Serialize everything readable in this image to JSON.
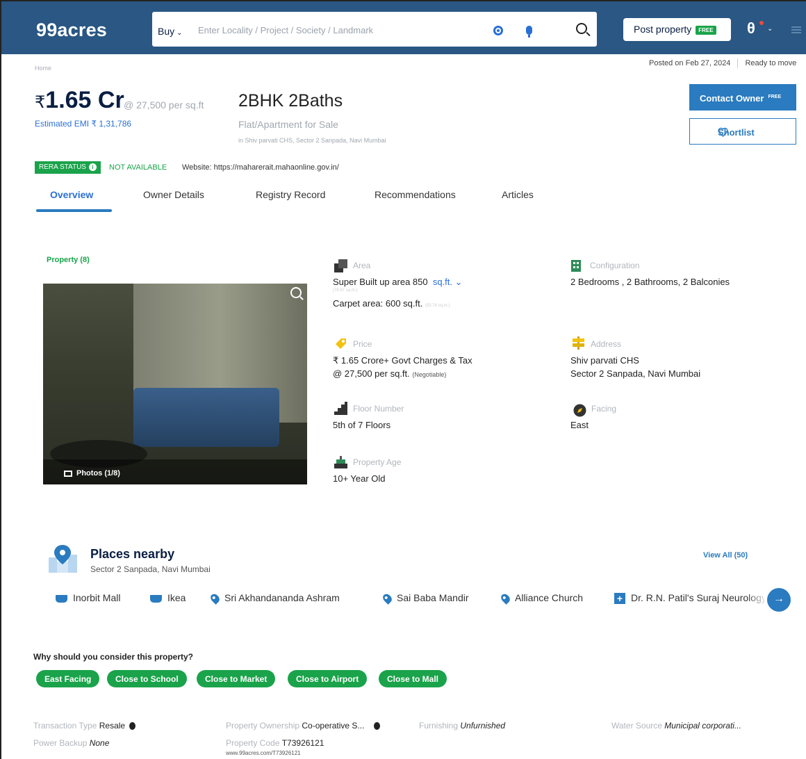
{
  "header": {
    "logo": "99acres",
    "search_mode": "Buy",
    "search_placeholder": "Enter Locality / Project / Society / Landmark",
    "post_property_label": "Post property",
    "post_property_badge": "FREE"
  },
  "breadcrumb": "Home",
  "posted": {
    "date": "Posted on Feb 27, 2024",
    "status": "Ready to move"
  },
  "listing": {
    "price": "1.65 Cr",
    "currency": "₹",
    "per_sqft": "@ 27,500 per sq.ft",
    "emi": "Estimated EMI ₹ 1,31,786",
    "title": "2BHK 2Baths",
    "subtitle": "Flat/Apartment for Sale",
    "address_line": "in Shiv parvati CHS, Sector 2 Sanpada, Navi Mumbai"
  },
  "actions": {
    "contact_owner": "Contact Owner",
    "contact_badge": "FREE",
    "shortlist": "Shortlist"
  },
  "rera": {
    "badge": "RERA STATUS",
    "status": "NOT AVAILABLE",
    "website": "Website: https://maharerait.mahaonline.gov.in/"
  },
  "tabs": [
    "Overview",
    "Owner Details",
    "Registry Record",
    "Recommendations",
    "Articles"
  ],
  "property_label": "Property (8)",
  "photos_label": "Photos (1/8)",
  "details": {
    "area": {
      "label": "Area",
      "value": "Super Built up area 850",
      "unit": "sq.ft.",
      "sub": "(78.97 sq.m.)",
      "carpet": "Carpet area: 600 sq.ft.",
      "carpet_sub": "(55.74 sq.m.)"
    },
    "configuration": {
      "label": "Configuration",
      "value": "2 Bedrooms , 2 Bathrooms, 2 Balconies"
    },
    "price": {
      "label": "Price",
      "line1": "₹ 1.65 Crore+ Govt Charges & Tax",
      "line2": "@ 27,500 per sq.ft.",
      "negotiable": "(Negotiable)"
    },
    "address": {
      "label": "Address",
      "line1": "Shiv parvati CHS",
      "line2": "Sector 2 Sanpada, Navi Mumbai"
    },
    "floor": {
      "label": "Floor Number",
      "value": "5th  of 7 Floors"
    },
    "facing": {
      "label": "Facing",
      "value": "East"
    },
    "age": {
      "label": "Property Age",
      "value": "10+ Year Old"
    }
  },
  "places": {
    "title": "Places nearby",
    "subtitle": "Sector 2 Sanpada, Navi Mumbai",
    "view_all": "View All (50)",
    "items": [
      {
        "name": "Inorbit Mall",
        "icon": "shopping-bag-icon"
      },
      {
        "name": "Ikea",
        "icon": "shopping-bag-icon"
      },
      {
        "name": "Sri Akhandananda Ashram",
        "icon": "location-pin-icon"
      },
      {
        "name": "Sai Baba Mandir",
        "icon": "location-pin-icon"
      },
      {
        "name": "Alliance Church",
        "icon": "location-pin-icon"
      },
      {
        "name": "Dr. R.N. Patil's Suraj Neurology",
        "icon": "hospital-cross-icon"
      }
    ]
  },
  "why_consider": {
    "title": "Why should you consider this property?",
    "chips": [
      "East Facing",
      "Close to School",
      "Close to Market",
      "Close to Airport",
      "Close to Mall"
    ]
  },
  "info": {
    "transaction_key": "Transaction Type",
    "transaction_val": "Resale",
    "ownership_key": "Property Ownership",
    "ownership_val": "Co-operative S...",
    "furnishing_key": "Furnishing",
    "furnishing_val": "Unfurnished",
    "water_key": "Water Source",
    "water_val": "Municipal corporati...",
    "power_key": "Power Backup",
    "power_val": "None",
    "code_key": "Property Code",
    "code_val": "T73926121",
    "code_url": "www.99acres.com/T73926121"
  },
  "colors": {
    "header": "#2a5783",
    "accent": "#2a7bbf",
    "green": "#1aa34a"
  }
}
